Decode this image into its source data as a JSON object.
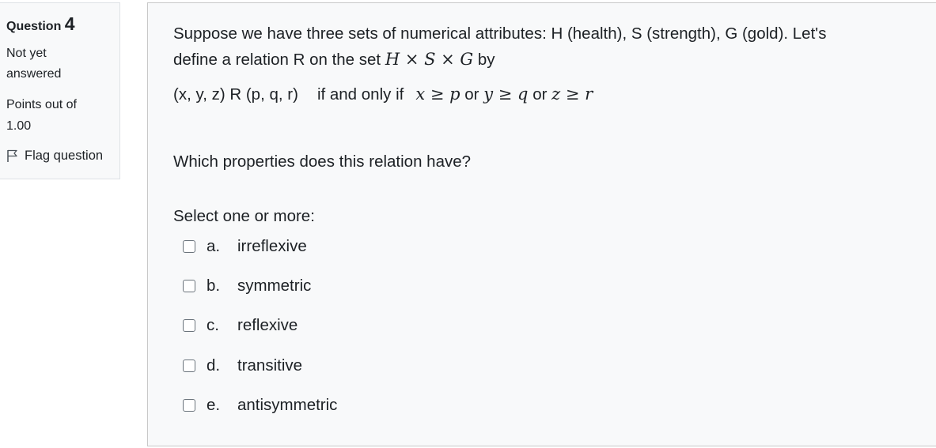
{
  "info": {
    "question_prefix": "Question",
    "question_number": "4",
    "state_line1": "Not yet",
    "state_line2": "answered",
    "grade_line1": "Points out of",
    "grade_line2": "1.00",
    "flag_label": "Flag question"
  },
  "question": {
    "intro": "Suppose we have three sets of numerical attributes:  H (health), S (strength), G (gold).    Let's",
    "intro2_pre": "define a relation R on the set",
    "set_expr": "H × S × G",
    "intro2_post": "by",
    "relation_lhs": "(x, y, z)  R  (p, q, r)",
    "iff_text": "if and only if",
    "cond1": "x ≥ p",
    "or1": "or",
    "cond2": "y ≥ q",
    "or2": "or",
    "cond3": "z ≥ r",
    "which": "Which properties does this relation have?"
  },
  "answer": {
    "prompt": "Select one or more:",
    "options": [
      {
        "letter": "a.",
        "label": "irreflexive",
        "checked": false
      },
      {
        "letter": "b.",
        "label": "symmetric",
        "checked": false
      },
      {
        "letter": "c.",
        "label": "reflexive",
        "checked": false
      },
      {
        "letter": "d.",
        "label": "transitive",
        "checked": false
      },
      {
        "letter": "e.",
        "label": "antisymmetric",
        "checked": false
      }
    ]
  }
}
